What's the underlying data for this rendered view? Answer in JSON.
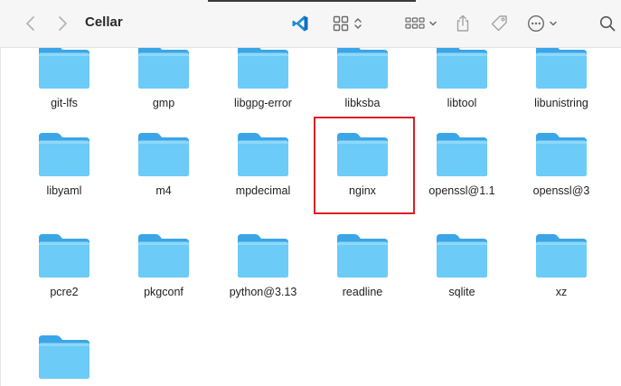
{
  "window": {
    "title": "Cellar",
    "toolbar": {
      "back_icon": "chevron-left-icon",
      "forward_icon": "chevron-right-icon",
      "app_icon": "vscode-icon",
      "view_icon": "icon-grid-view-icon",
      "group_icon": "group-by-icon",
      "share_icon": "share-icon",
      "tag_icon": "tag-icon",
      "action_icon": "more-actions-icon",
      "search_icon": "search-icon"
    }
  },
  "grid": {
    "rows": [
      [
        "git-lfs",
        "gmp",
        "libgpg-error",
        "libksba",
        "libtool",
        "libunistring"
      ],
      [
        "libyaml",
        "m4",
        "mpdecimal",
        "nginx",
        "openssl@1.1",
        "openssl@3"
      ],
      [
        "pcre2",
        "pkgconf",
        "python@3.13",
        "readline",
        "sqlite",
        "xz"
      ],
      [
        ""
      ]
    ]
  },
  "selection": {
    "item": "nginx",
    "highlight_color": "#dd1f26"
  },
  "colors": {
    "folder_front": "#6ccbf7",
    "folder_back": "#3aa6e8",
    "accent": "#dd1f26"
  }
}
